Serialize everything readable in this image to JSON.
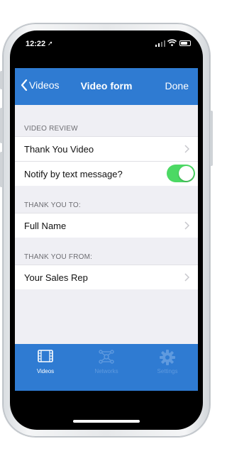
{
  "status_bar": {
    "time": "12:22",
    "location_glyph": "➚"
  },
  "nav": {
    "back_label": "Videos",
    "title": "Video form",
    "done_label": "Done"
  },
  "sections": [
    {
      "header": "VIDEO REVIEW",
      "rows": [
        {
          "label": "Thank You Video",
          "accessory": "chevron"
        },
        {
          "label": "Notify by text message?",
          "accessory": "toggle",
          "toggle_on": true
        }
      ]
    },
    {
      "header": "THANK YOU TO:",
      "rows": [
        {
          "label": "Full Name",
          "accessory": "chevron"
        }
      ]
    },
    {
      "header": "THANK YOU FROM:",
      "rows": [
        {
          "label": "Your Sales Rep",
          "accessory": "chevron"
        }
      ]
    }
  ],
  "tabs": [
    {
      "label": "Videos",
      "icon": "film-icon",
      "active": true
    },
    {
      "label": "Networks",
      "icon": "network-icon",
      "active": false
    },
    {
      "label": "Settings",
      "icon": "gear-icon",
      "active": false
    }
  ],
  "colors": {
    "accent": "#2f7bd2",
    "toggle_on": "#4cd964",
    "background": "#efeff4",
    "inactive_tab": "#5f9adf"
  }
}
